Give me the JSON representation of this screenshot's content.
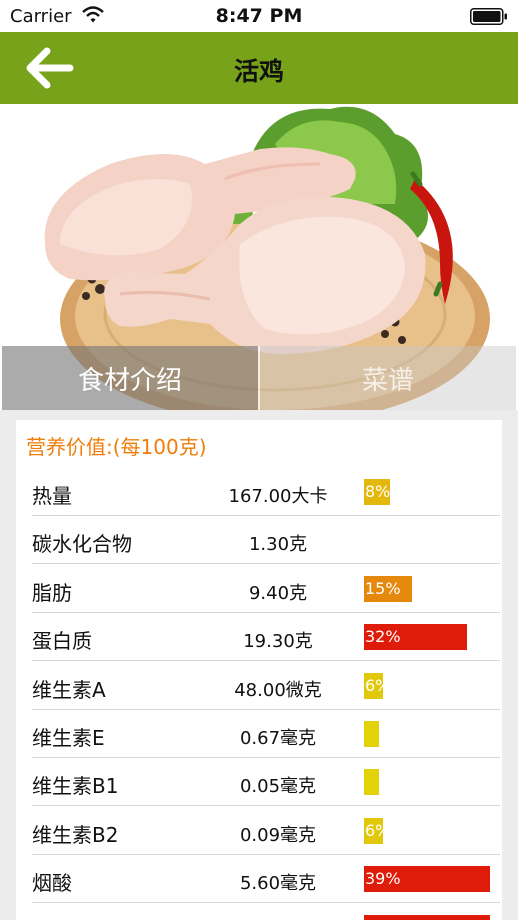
{
  "status_bar": {
    "carrier": "Carrier",
    "time": "8:47 PM"
  },
  "nav": {
    "title": "活鸡"
  },
  "tabs": [
    {
      "label": "食材介绍",
      "active": true
    },
    {
      "label": "菜谱",
      "active": false
    }
  ],
  "nutrition": {
    "heading": "营养价值:(每100克)",
    "rows": [
      {
        "name": "热量",
        "amount": "167.00大卡",
        "percent_label": "8%",
        "level": 0.08,
        "color": "#e3b70b"
      },
      {
        "name": "碳水化合物",
        "amount": "1.30克",
        "percent_label": "",
        "level": 0,
        "color": ""
      },
      {
        "name": "脂肪",
        "amount": "9.40克",
        "percent_label": "15%",
        "level": 0.15,
        "color": "#e5890e"
      },
      {
        "name": "蛋白质",
        "amount": "19.30克",
        "percent_label": "32%",
        "level": 0.32,
        "color": "#df1c0a"
      },
      {
        "name": "维生素A",
        "amount": "48.00微克",
        "percent_label": "6%",
        "level": 0.06,
        "color": "#e2c80a"
      },
      {
        "name": "维生素E",
        "amount": "0.67毫克",
        "percent_label": "",
        "level": 0.04,
        "color": "#e2d20a"
      },
      {
        "name": "维生素B1",
        "amount": "0.05毫克",
        "percent_label": "",
        "level": 0.03,
        "color": "#e2d20a"
      },
      {
        "name": "维生素B2",
        "amount": "0.09毫克",
        "percent_label": "6%",
        "level": 0.06,
        "color": "#e2c80a"
      },
      {
        "name": "烟酸",
        "amount": "5.60毫克",
        "percent_label": "39%",
        "level": 0.39,
        "color": "#df1c0a"
      },
      {
        "name": "",
        "amount": "",
        "percent_label": "",
        "level": 0.39,
        "color": "#df1c0a"
      }
    ]
  }
}
